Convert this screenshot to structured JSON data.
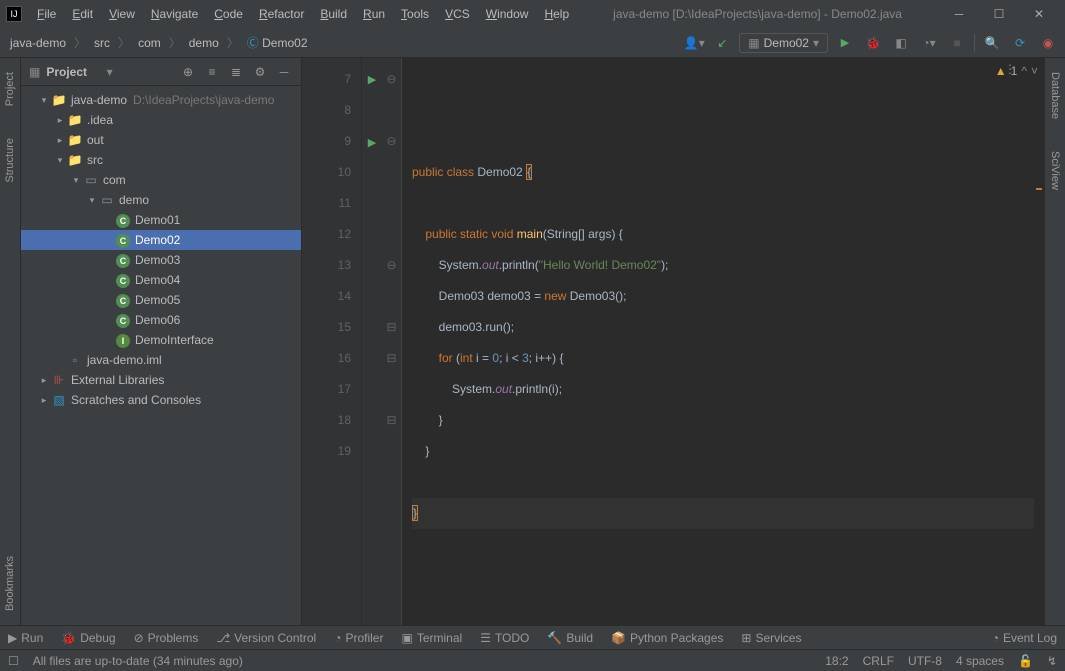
{
  "title": "java-demo [D:\\IdeaProjects\\java-demo] - Demo02.java",
  "menu": [
    "File",
    "Edit",
    "View",
    "Navigate",
    "Code",
    "Refactor",
    "Build",
    "Run",
    "Tools",
    "VCS",
    "Window",
    "Help"
  ],
  "breadcrumb": [
    "java-demo",
    "src",
    "com",
    "demo",
    "Demo02"
  ],
  "run_config": "Demo02",
  "project_panel": {
    "title": "Project",
    "root": {
      "name": "java-demo",
      "path": "D:\\IdeaProjects\\java-demo"
    },
    "nodes": [
      {
        "indent": 1,
        "arrow": "▾",
        "icon": "folder-blue",
        "label": "java-demo",
        "dim": "D:\\IdeaProjects\\java-demo"
      },
      {
        "indent": 2,
        "arrow": "▸",
        "icon": "folder",
        "label": ".idea"
      },
      {
        "indent": 2,
        "arrow": "▸",
        "icon": "folder-orange",
        "label": "out"
      },
      {
        "indent": 2,
        "arrow": "▾",
        "icon": "folder-blue",
        "label": "src"
      },
      {
        "indent": 3,
        "arrow": "▾",
        "icon": "folder-gray",
        "label": "com"
      },
      {
        "indent": 4,
        "arrow": "▾",
        "icon": "folder-gray",
        "label": "demo"
      },
      {
        "indent": 5,
        "arrow": "",
        "icon": "class",
        "label": "Demo01"
      },
      {
        "indent": 5,
        "arrow": "",
        "icon": "class",
        "label": "Demo02",
        "selected": true
      },
      {
        "indent": 5,
        "arrow": "",
        "icon": "class",
        "label": "Demo03"
      },
      {
        "indent": 5,
        "arrow": "",
        "icon": "class",
        "label": "Demo04"
      },
      {
        "indent": 5,
        "arrow": "",
        "icon": "class",
        "label": "Demo05"
      },
      {
        "indent": 5,
        "arrow": "",
        "icon": "class",
        "label": "Demo06"
      },
      {
        "indent": 5,
        "arrow": "",
        "icon": "interface",
        "label": "DemoInterface"
      },
      {
        "indent": 2,
        "arrow": "",
        "icon": "iml",
        "label": "java-demo.iml"
      },
      {
        "indent": 1,
        "arrow": "▸",
        "icon": "lib",
        "label": "External Libraries"
      },
      {
        "indent": 1,
        "arrow": "▸",
        "icon": "scratch",
        "label": "Scratches and Consoles"
      }
    ]
  },
  "editor": {
    "line_start": 7,
    "line_end": 19,
    "run_markers": [
      7,
      9
    ],
    "fold_markers": {
      "7": "⊖",
      "9": "⊖",
      "13": "⊖",
      "15": "⊟",
      "16": "⊟",
      "18": "⊟"
    },
    "inspection": {
      "warnings": 1
    },
    "lines": [
      {
        "n": 7,
        "tokens": [
          [
            "kw",
            "public "
          ],
          [
            "kw",
            "class "
          ],
          [
            "tok",
            "Demo02 "
          ],
          [
            "brace",
            "{"
          ]
        ]
      },
      {
        "n": 8,
        "tokens": []
      },
      {
        "n": 9,
        "tokens": [
          [
            "sp",
            "    "
          ],
          [
            "kw",
            "public "
          ],
          [
            "kw",
            "static "
          ],
          [
            "kw",
            "void "
          ],
          [
            "method",
            "main"
          ],
          [
            "tok",
            "(String[] args) {"
          ]
        ]
      },
      {
        "n": 10,
        "tokens": [
          [
            "sp",
            "        "
          ],
          [
            "tok",
            "System."
          ],
          [
            "field",
            "out"
          ],
          [
            "tok",
            ".println("
          ],
          [
            "str",
            "\"Hello World! Demo02\""
          ],
          [
            "tok",
            ");"
          ]
        ]
      },
      {
        "n": 11,
        "tokens": [
          [
            "sp",
            "        "
          ],
          [
            "tok",
            "Demo03 demo03 = "
          ],
          [
            "kw",
            "new "
          ],
          [
            "tok",
            "Demo03();"
          ]
        ]
      },
      {
        "n": 12,
        "tokens": [
          [
            "sp",
            "        "
          ],
          [
            "tok",
            "demo03.run();"
          ]
        ]
      },
      {
        "n": 13,
        "tokens": [
          [
            "sp",
            "        "
          ],
          [
            "kw",
            "for "
          ],
          [
            "tok",
            "("
          ],
          [
            "kw",
            "int "
          ],
          [
            "tok",
            "i = "
          ],
          [
            "num",
            "0"
          ],
          [
            "tok",
            "; i < "
          ],
          [
            "num",
            "3"
          ],
          [
            "tok",
            "; i++) {"
          ]
        ]
      },
      {
        "n": 14,
        "tokens": [
          [
            "sp",
            "            "
          ],
          [
            "tok",
            "System."
          ],
          [
            "field",
            "out"
          ],
          [
            "tok",
            ".println(i);"
          ]
        ]
      },
      {
        "n": 15,
        "tokens": [
          [
            "sp",
            "        "
          ],
          [
            "tok",
            "}"
          ]
        ]
      },
      {
        "n": 16,
        "tokens": [
          [
            "sp",
            "    "
          ],
          [
            "tok",
            "}"
          ]
        ]
      },
      {
        "n": 17,
        "tokens": []
      },
      {
        "n": 18,
        "tokens": [
          [
            "brace",
            "}"
          ]
        ],
        "active": true
      },
      {
        "n": 19,
        "tokens": []
      }
    ]
  },
  "bottom_tools": [
    "Run",
    "Debug",
    "Problems",
    "Version Control",
    "Profiler",
    "Terminal",
    "TODO",
    "Build",
    "Python Packages",
    "Services"
  ],
  "event_log": "Event Log",
  "status": {
    "msg": "All files are up-to-date (34 minutes ago)",
    "pos": "18:2",
    "eol": "CRLF",
    "enc": "UTF-8",
    "indent": "4 spaces"
  },
  "left_tabs": [
    "Project",
    "Structure",
    "Bookmarks"
  ],
  "right_tabs": [
    "Database",
    "SciView"
  ]
}
